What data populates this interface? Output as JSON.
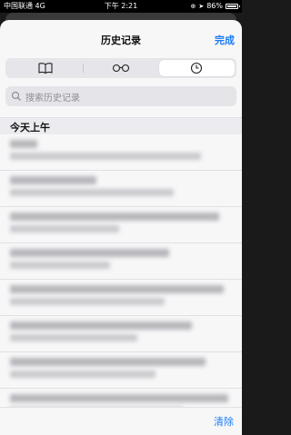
{
  "status_bar": {
    "carrier": "中国联通",
    "network": "4G",
    "time": "下午 2:21",
    "battery_percent": "86%",
    "battery_level": 0.86
  },
  "nav": {
    "title": "历史记录",
    "done_label": "完成"
  },
  "tabs": [
    {
      "name": "bookmarks",
      "icon": "book-icon",
      "active": false
    },
    {
      "name": "reading-list",
      "icon": "glasses-icon",
      "active": false
    },
    {
      "name": "history",
      "icon": "clock-icon",
      "active": true
    }
  ],
  "search": {
    "placeholder": "搜索历史记录"
  },
  "section": {
    "title": "今天上午"
  },
  "history_items_count_visible": 8,
  "toolbar": {
    "clear_label": "清除"
  },
  "colors": {
    "accent": "#1a7cf7",
    "background": "#f7f7f8"
  }
}
